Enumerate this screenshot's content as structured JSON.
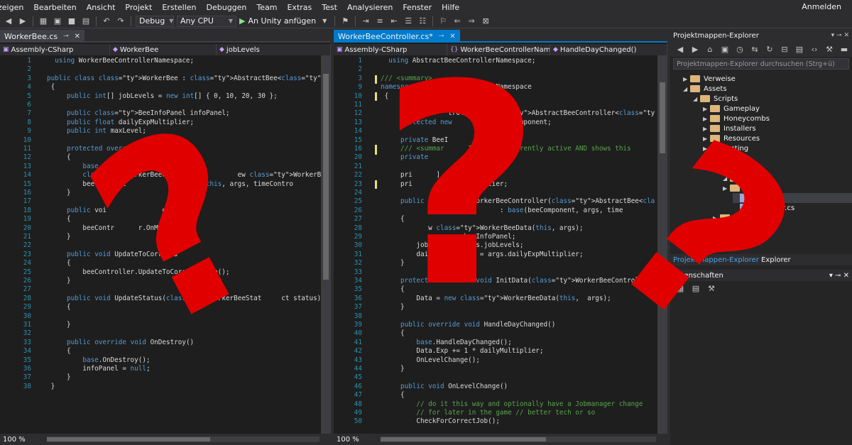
{
  "menu": [
    "zeigen",
    "Bearbeiten",
    "Ansicht",
    "Projekt",
    "Erstellen",
    "Debuggen",
    "Team",
    "Extras",
    "Test",
    "Analysieren",
    "Fenster",
    "Hilfe"
  ],
  "signin": "Anmelden",
  "toolbar": {
    "config": "Debug",
    "platform": "Any CPU",
    "attach": "An Unity anfügen"
  },
  "left_editor": {
    "tab": "WorkerBee.cs",
    "nav": [
      "Assembly-CSharp",
      "WorkerBee",
      "jobLevels"
    ],
    "zoom": "100 %",
    "lines": [
      {
        "n": "1",
        "t": "  using WorkerBeeControllerNamespace;"
      },
      {
        "n": "2",
        "t": ""
      },
      {
        "n": "3",
        "t": "public class WorkerBee : AbstractBee<WorkerBeeController>"
      },
      {
        "n": "4",
        "t": " {"
      },
      {
        "n": "5",
        "t": "     public int[] jobLevels = new int[] { 0, 10, 20, 30 };"
      },
      {
        "n": "6",
        "t": ""
      },
      {
        "n": "7",
        "t": "     public BeeInfoPanel infoPanel;"
      },
      {
        "n": "8",
        "t": "     public float dailyExpMultiplier;"
      },
      {
        "n": "9",
        "t": "     public int maxLevel;"
      },
      {
        "n": "10",
        "t": ""
      },
      {
        "n": "11",
        "t": "     protected override void Awake()"
      },
      {
        "n": "12",
        "t": "     {"
      },
      {
        "n": "13",
        "t": "         base.Awake();"
      },
      {
        "n": "14",
        "t": "         WorkerBeeCont               ew WorkerBeeControllerArgs(ave"
      },
      {
        "n": "15",
        "t": "         beeControll              oller(this, args, timeContro"
      },
      {
        "n": "16",
        "t": "     }"
      },
      {
        "n": "17",
        "t": ""
      },
      {
        "n": "18",
        "t": "     public voi              eDown()"
      },
      {
        "n": "19",
        "t": "     {"
      },
      {
        "n": "20",
        "t": "         beeContr      r.OnMouseDown("
      },
      {
        "n": "21",
        "t": "     }"
      },
      {
        "n": "22",
        "t": ""
      },
      {
        "n": "23",
        "t": "     public void UpdateToCorrectJ"
      },
      {
        "n": "24",
        "t": "     {"
      },
      {
        "n": "25",
        "t": "         beeController.UpdateToCorrec    ob();"
      },
      {
        "n": "26",
        "t": "     }"
      },
      {
        "n": "27",
        "t": ""
      },
      {
        "n": "28",
        "t": "     public void UpdateStatus(WorkerBeeStat     ct status)"
      },
      {
        "n": "29",
        "t": "     {"
      },
      {
        "n": "30",
        "t": ""
      },
      {
        "n": "31",
        "t": "     }"
      },
      {
        "n": "32",
        "t": ""
      },
      {
        "n": "33",
        "t": "     public override void OnDestroy()"
      },
      {
        "n": "34",
        "t": "     {"
      },
      {
        "n": "35",
        "t": "         base.OnDestroy();"
      },
      {
        "n": "36",
        "t": "         infoPanel = null;"
      },
      {
        "n": "37",
        "t": "     }"
      },
      {
        "n": "38",
        "t": " }"
      }
    ]
  },
  "mid_editor": {
    "tab": "WorkerBeeController.cs*",
    "nav": [
      "Assembly-CSharp",
      "WorkerBeeControllerNamespac",
      "HandleDayChanged()"
    ],
    "zoom": "100 %",
    "lines": [
      {
        "n": "1",
        "t": "  using AbstractBeeControllerNamespace;"
      },
      {
        "n": "2",
        "t": ""
      },
      {
        "n": "3",
        "t": "/// <summary>"
      },
      {
        "n": "9",
        "t": "namespace WorkerBeeControllerNamespace"
      },
      {
        "n": "10",
        "t": " {"
      },
      {
        "n": "11",
        "t": ""
      },
      {
        "n": "12",
        "t": "                 troller : AbstractBeeController<WorkerBee"
      },
      {
        "n": "13",
        "t": "     protected new            beeComponent;"
      },
      {
        "n": "14",
        "t": ""
      },
      {
        "n": "15",
        "t": "     private BeeI       nfoPanel;"
      },
      {
        "n": "16",
        "t": "     /// <summar      InfoPanel currently active AND shows this"
      },
      {
        "n": "20",
        "t": "     private            Selected;"
      },
      {
        "n": "21",
        "t": ""
      },
      {
        "n": "22",
        "t": "     pri      ] jobLevels;"
      },
      {
        "n": "23",
        "t": "     pri      t dailyMultiplier;"
      },
      {
        "n": "24",
        "t": ""
      },
      {
        "n": "25",
        "t": "     public WorkerBeeController(AbstractBee<WorkerBeeController> bee"
      },
      {
        "n": "26",
        "t": "                              : base(beeComponent, args, time"
      },
      {
        "n": "27",
        "t": "     {"
      },
      {
        "n": "28",
        "t": "            w WorkerBeeData(this, args);"
      },
      {
        "n": "29",
        "t": "              = args.beeInfoPanel;"
      },
      {
        "n": "30",
        "t": "         jobLevels = args.jobLevels;"
      },
      {
        "n": "31",
        "t": "         dailyMultiplier = args.dailyExpMultiplier;"
      },
      {
        "n": "32",
        "t": "     }"
      },
      {
        "n": "33",
        "t": ""
      },
      {
        "n": "34",
        "t": "     protected override void InitData(WorkerBeeControllerArgs args"
      },
      {
        "n": "35",
        "t": "     {"
      },
      {
        "n": "36",
        "t": "         Data = new WorkerBeeData(this,  args);"
      },
      {
        "n": "37",
        "t": "     }"
      },
      {
        "n": "38",
        "t": ""
      },
      {
        "n": "39",
        "t": "     public override void HandleDayChanged()"
      },
      {
        "n": "40",
        "t": "     {"
      },
      {
        "n": "41",
        "t": "         base.HandleDayChanged();"
      },
      {
        "n": "42",
        "t": "         Data.Exp += 1 * dailyMultiplier;"
      },
      {
        "n": "43",
        "t": "         OnLevelChange();"
      },
      {
        "n": "44",
        "t": "     }"
      },
      {
        "n": "45",
        "t": ""
      },
      {
        "n": "46",
        "t": "     public void OnLevelChange()"
      },
      {
        "n": "47",
        "t": "     {"
      },
      {
        "n": "48",
        "t": "         // do it this way and optionally have a Jobmanager change"
      },
      {
        "n": "49",
        "t": "         // for later in the game // better tech or so"
      },
      {
        "n": "50",
        "t": "         CheckForCorrectJob();"
      }
    ]
  },
  "solution_explorer": {
    "title": "Projektmappen-Explorer",
    "search_placeholder": "Projektmappen-Explorer durchsuchen (Strg+ü)",
    "items": [
      {
        "label": "Verweise",
        "depth": 1,
        "kind": "ref"
      },
      {
        "label": "Assets",
        "depth": 1,
        "kind": "folder"
      },
      {
        "label": "Scripts",
        "depth": 2,
        "kind": "folder"
      },
      {
        "label": "Gameplay",
        "depth": 3,
        "kind": "folder"
      },
      {
        "label": "Honeycombs",
        "depth": 3,
        "kind": "folder"
      },
      {
        "label": "Installers",
        "depth": 3,
        "kind": "folder"
      },
      {
        "label": "Resources",
        "depth": 3,
        "kind": "folder"
      },
      {
        "label": "Testing",
        "depth": 3,
        "kind": "folder"
      },
      {
        "label": "its",
        "depth": 3,
        "kind": "folder"
      },
      {
        "label": "ctBee",
        "depth": 4,
        "kind": "folder"
      },
      {
        "label": "",
        "depth": 5,
        "kind": "folder"
      },
      {
        "label": "",
        "depth": 5,
        "kind": "folder"
      },
      {
        "label": "s.cs",
        "depth": 6,
        "kind": "file"
      },
      {
        "label": "Controller.cs",
        "depth": 6,
        "kind": "file"
      },
      {
        "label": "UserInt",
        "depth": 4,
        "kind": "folder"
      }
    ],
    "bottom_tab": "Explorer"
  },
  "properties": {
    "title": "Eigenschaften"
  },
  "overlay_glyph": "?",
  "colors": {
    "accent": "#007acc",
    "overlay": "#e10000"
  }
}
